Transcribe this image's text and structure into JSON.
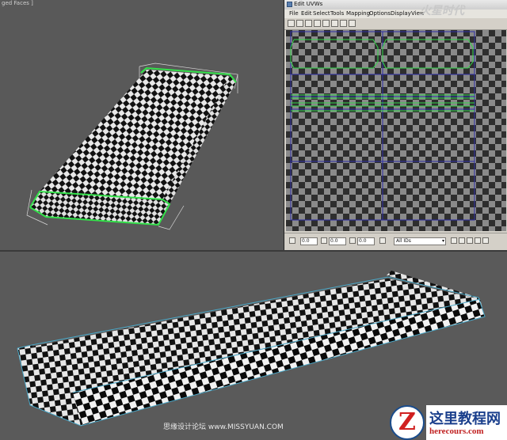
{
  "viewports": {
    "top_label": "ged Faces ]"
  },
  "uv_editor": {
    "title": "Edit UVWs",
    "menus": [
      "File",
      "Edit",
      "Select",
      "Tools",
      "Mapping",
      "Options",
      "Display",
      "View"
    ],
    "toolbar_icons": [
      "move-icon",
      "rotate-icon",
      "scale-icon",
      "freeform-icon",
      "mirror-icon",
      "link-icon",
      "unlink-icon",
      "map-icon"
    ],
    "status": {
      "u_value": "0.0",
      "v_value": "0.0",
      "w_value": "0.0",
      "ids_select": "All IDs"
    },
    "colors": {
      "grid_line": "#2f2fa8",
      "uv_edge": "#32d84a",
      "checker_dark": "#2a2a2a",
      "checker_light": "#8a8a8a"
    }
  },
  "overlay": {
    "corner_logo": "火星时代",
    "credit": "思缘设计论坛  www.MISSYUAN.COM",
    "watermark_title": "这里教程网",
    "watermark_url": "herecours.com",
    "watermark_letter": "Z"
  }
}
